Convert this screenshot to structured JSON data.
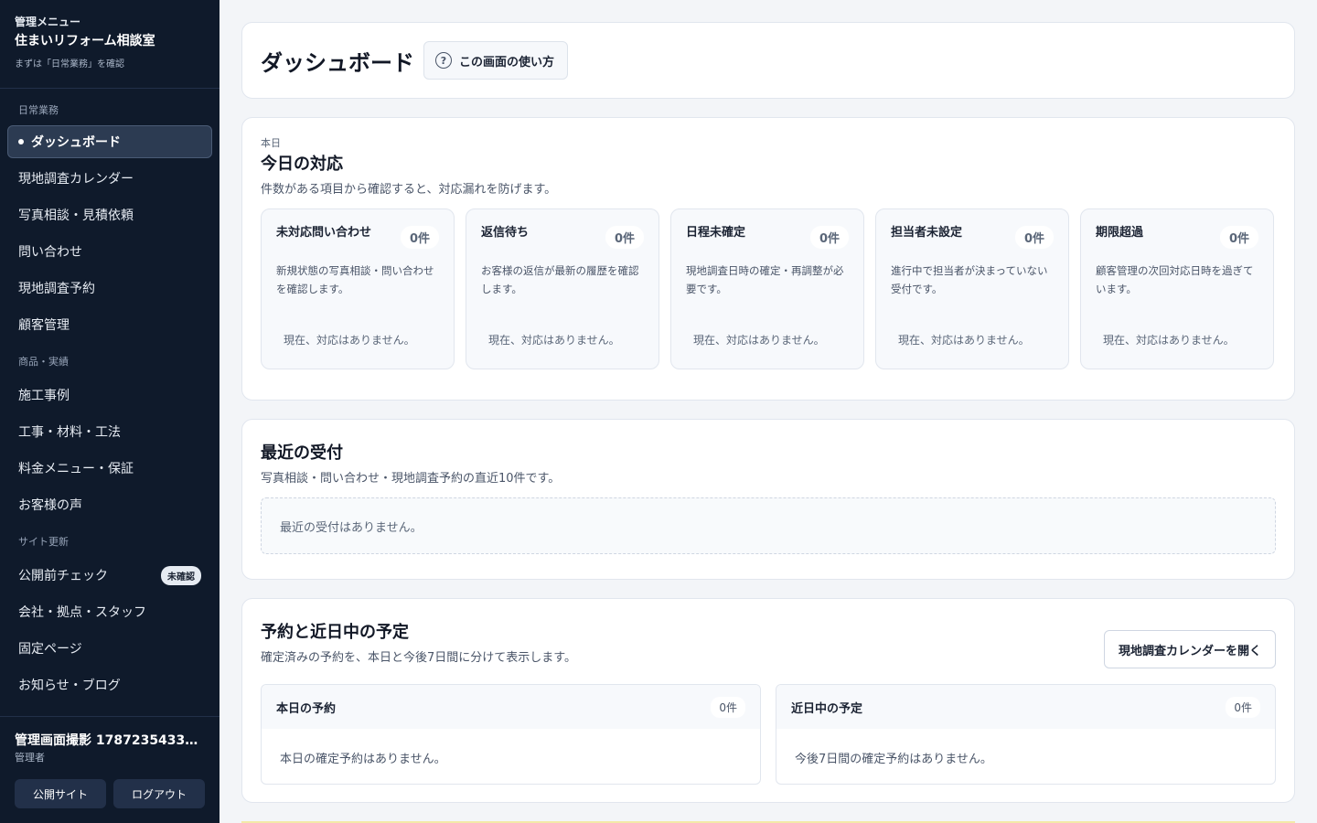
{
  "sidebar": {
    "kicker": "管理メニュー",
    "title": "住まいリフォーム相談室",
    "hint": "まずは「日常業務」を確認",
    "sections": [
      {
        "label": "日常業務",
        "items": [
          {
            "label": "ダッシュボード",
            "active": true
          },
          {
            "label": "現地調査カレンダー"
          },
          {
            "label": "写真相談・見積依頼"
          },
          {
            "label": "問い合わせ"
          },
          {
            "label": "現地調査予約"
          },
          {
            "label": "顧客管理"
          }
        ]
      },
      {
        "label": "商品・実績",
        "items": [
          {
            "label": "施工事例"
          },
          {
            "label": "工事・材料・工法"
          },
          {
            "label": "料金メニュー・保証"
          },
          {
            "label": "お客様の声"
          }
        ]
      },
      {
        "label": "サイト更新",
        "items": [
          {
            "label": "公開前チェック",
            "badge": "未確認"
          },
          {
            "label": "会社・拠点・スタッフ"
          },
          {
            "label": "固定ページ"
          },
          {
            "label": "お知らせ・ブログ"
          }
        ]
      }
    ],
    "user": {
      "name": "管理画面撮影 17872354334…",
      "role": "管理者"
    },
    "buttons": {
      "public_site": "公開サイト",
      "logout": "ログアウト"
    }
  },
  "header": {
    "title": "ダッシュボード",
    "help_label": "この画面の使い方",
    "help_icon": "question-circle-icon"
  },
  "today": {
    "kicker": "本日",
    "title": "今日の対応",
    "desc": "件数がある項目から確認すると、対応漏れを防げます。",
    "tasks": [
      {
        "title": "未対応問い合わせ",
        "count": "0件",
        "desc": "新規状態の写真相談・問い合わせを確認します。",
        "empty": "現在、対応はありません。"
      },
      {
        "title": "返信待ち",
        "count": "0件",
        "desc": "お客様の返信が最新の履歴を確認します。",
        "empty": "現在、対応はありません。"
      },
      {
        "title": "日程未確定",
        "count": "0件",
        "desc": "現地調査日時の確定・再調整が必要です。",
        "empty": "現在、対応はありません。"
      },
      {
        "title": "担当者未設定",
        "count": "0件",
        "desc": "進行中で担当者が決まっていない受付です。",
        "empty": "現在、対応はありません。"
      },
      {
        "title": "期限超過",
        "count": "0件",
        "desc": "顧客管理の次回対応日時を過ぎています。",
        "empty": "現在、対応はありません。"
      }
    ]
  },
  "recent": {
    "title": "最近の受付",
    "desc": "写真相談・問い合わせ・現地調査予約の直近10件です。",
    "empty": "最近の受付はありません。"
  },
  "schedule": {
    "title": "予約と近日中の予定",
    "desc": "確定済みの予約を、本日と今後7日間に分けて表示します。",
    "calendar_button": "現地調査カレンダーを開く",
    "columns": [
      {
        "title": "本日の予約",
        "count": "0件",
        "empty": "本日の確定予約はありません。"
      },
      {
        "title": "近日中の予定",
        "count": "0件",
        "empty": "今後7日間の確定予約はありません。"
      }
    ]
  }
}
